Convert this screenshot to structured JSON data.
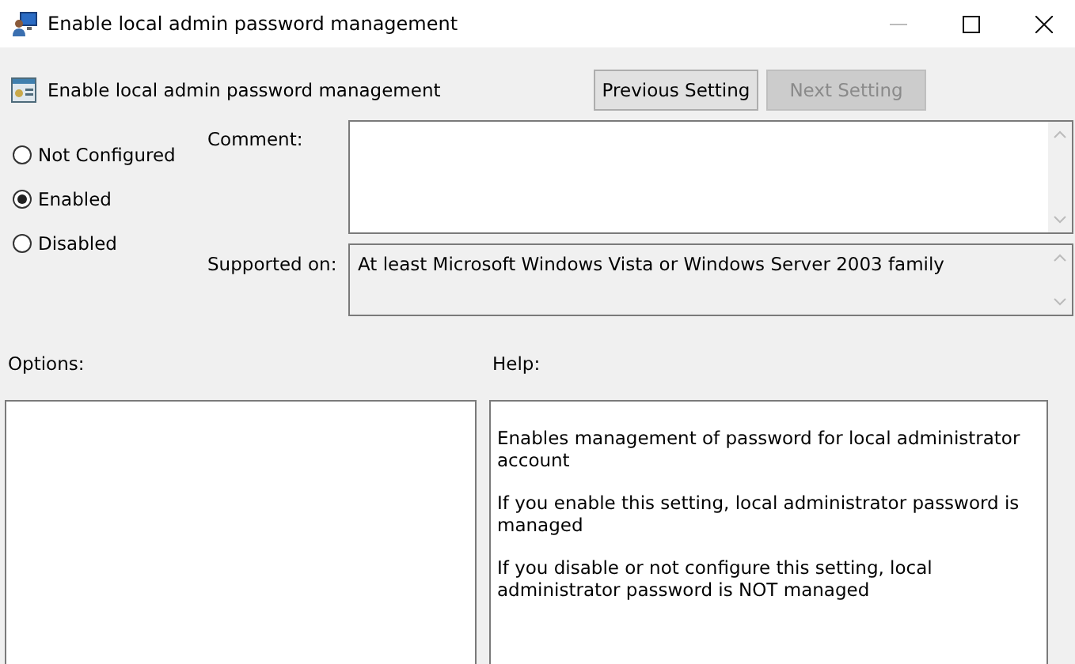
{
  "window": {
    "title": "Enable local admin password management"
  },
  "policy": {
    "title": "Enable local admin password management"
  },
  "buttons": [
    {
      "label": "Previous Setting",
      "disabled": false
    },
    {
      "label": "Next Setting",
      "disabled": true
    }
  ],
  "states": [
    {
      "label": "Not Configured",
      "selected": false
    },
    {
      "label": "Enabled",
      "selected": true
    },
    {
      "label": "Disabled",
      "selected": false
    }
  ],
  "comment": {
    "label": "Comment:"
  },
  "supported": {
    "label": "Supported on:",
    "value": "At least Microsoft Windows Vista or Windows Server 2003 family"
  },
  "options": {
    "label": "Options:"
  },
  "help": {
    "label": "Help:",
    "paragraphs": [
      "Enables management of password for local administrator account",
      "If you enable this setting, local administrator password is managed",
      "If you disable or not configure this setting, local administrator password is NOT managed"
    ]
  }
}
